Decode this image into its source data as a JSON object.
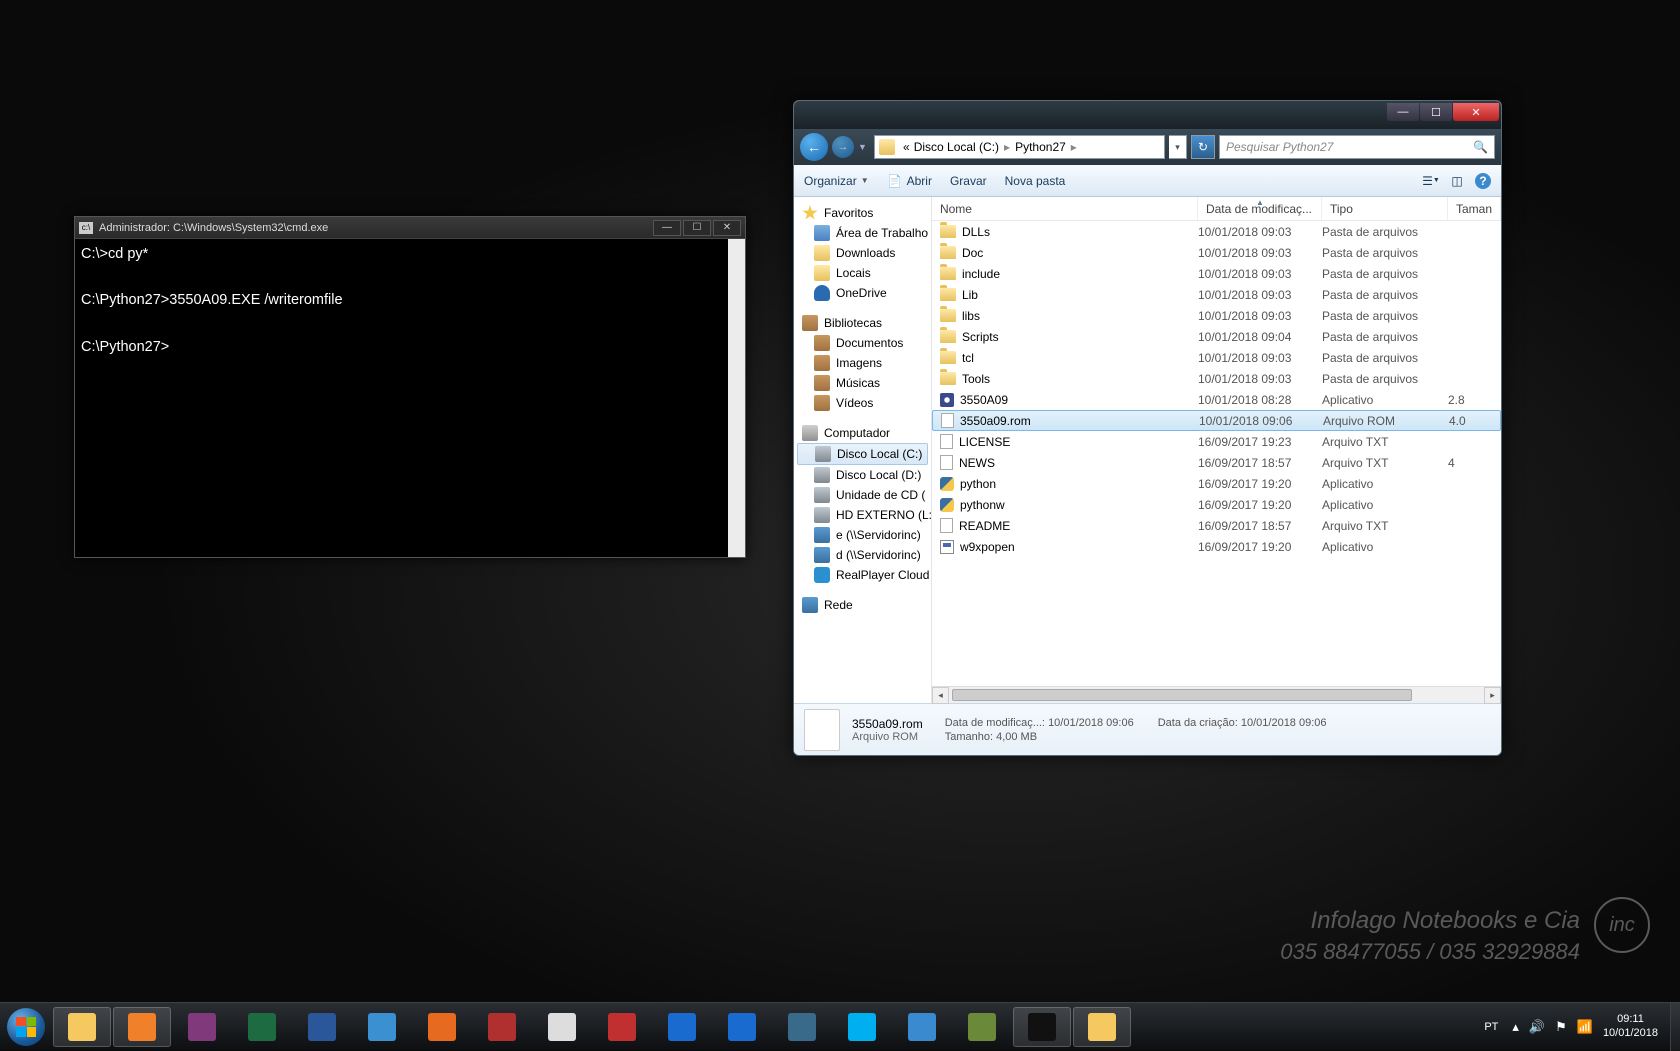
{
  "clock": {
    "time": "09:11",
    "date": "10/01/2018",
    "lang": "PT"
  },
  "watermark": {
    "line1": "Infolago Notebooks e Cia",
    "line2": "035 88477055 / 035 32929884",
    "circle": "inc"
  },
  "cmd": {
    "title": "Administrador: C:\\Windows\\System32\\cmd.exe",
    "body": "C:\\>cd py*\n\nC:\\Python27>3550A09.EXE /writeromfile\n\nC:\\Python27>"
  },
  "explorer": {
    "breadcrumb": {
      "prefix": "«",
      "part1": "Disco Local (C:)",
      "part2": "Python27"
    },
    "search_placeholder": "Pesquisar Python27",
    "toolbar": {
      "organize": "Organizar",
      "open": "Abrir",
      "burn": "Gravar",
      "newfolder": "Nova pasta"
    },
    "sidebar": {
      "favorites": {
        "label": "Favoritos",
        "items": [
          "Área de Trabalho",
          "Downloads",
          "Locais",
          "OneDrive"
        ]
      },
      "libraries": {
        "label": "Bibliotecas",
        "items": [
          "Documentos",
          "Imagens",
          "Músicas",
          "Vídeos"
        ]
      },
      "computer": {
        "label": "Computador",
        "items": [
          "Disco Local (C:)",
          "Disco Local (D:)",
          "Unidade de CD (",
          "HD EXTERNO (L:",
          "e (\\\\Servidorinc)",
          "d (\\\\Servidorinc)",
          "RealPlayer Cloud"
        ]
      },
      "network": {
        "label": "Rede"
      }
    },
    "columns": {
      "name": "Nome",
      "date": "Data de modificaç...",
      "type": "Tipo",
      "size": "Taman"
    },
    "files": [
      {
        "ico": "folder",
        "name": "DLLs",
        "date": "10/01/2018 09:03",
        "type": "Pasta de arquivos",
        "size": ""
      },
      {
        "ico": "folder",
        "name": "Doc",
        "date": "10/01/2018 09:03",
        "type": "Pasta de arquivos",
        "size": ""
      },
      {
        "ico": "folder",
        "name": "include",
        "date": "10/01/2018 09:03",
        "type": "Pasta de arquivos",
        "size": ""
      },
      {
        "ico": "folder",
        "name": "Lib",
        "date": "10/01/2018 09:03",
        "type": "Pasta de arquivos",
        "size": ""
      },
      {
        "ico": "folder",
        "name": "libs",
        "date": "10/01/2018 09:03",
        "type": "Pasta de arquivos",
        "size": ""
      },
      {
        "ico": "folder",
        "name": "Scripts",
        "date": "10/01/2018 09:04",
        "type": "Pasta de arquivos",
        "size": ""
      },
      {
        "ico": "folder",
        "name": "tcl",
        "date": "10/01/2018 09:03",
        "type": "Pasta de arquivos",
        "size": ""
      },
      {
        "ico": "folder",
        "name": "Tools",
        "date": "10/01/2018 09:03",
        "type": "Pasta de arquivos",
        "size": ""
      },
      {
        "ico": "exe",
        "name": "3550A09",
        "date": "10/01/2018 08:28",
        "type": "Aplicativo",
        "size": "2.8"
      },
      {
        "ico": "file",
        "name": "3550a09.rom",
        "date": "10/01/2018 09:06",
        "type": "Arquivo ROM",
        "size": "4.0",
        "selected": true
      },
      {
        "ico": "file",
        "name": "LICENSE",
        "date": "16/09/2017 19:23",
        "type": "Arquivo TXT",
        "size": ""
      },
      {
        "ico": "file",
        "name": "NEWS",
        "date": "16/09/2017 18:57",
        "type": "Arquivo TXT",
        "size": "4"
      },
      {
        "ico": "py",
        "name": "python",
        "date": "16/09/2017 19:20",
        "type": "Aplicativo",
        "size": ""
      },
      {
        "ico": "py",
        "name": "pythonw",
        "date": "16/09/2017 19:20",
        "type": "Aplicativo",
        "size": ""
      },
      {
        "ico": "file",
        "name": "README",
        "date": "16/09/2017 18:57",
        "type": "Arquivo TXT",
        "size": ""
      },
      {
        "ico": "app",
        "name": "w9xpopen",
        "date": "16/09/2017 19:20",
        "type": "Aplicativo",
        "size": ""
      }
    ],
    "details": {
      "filename": "3550a09.rom",
      "filetype": "Arquivo ROM",
      "mod_label": "Data de modificaç...:",
      "mod_value": "10/01/2018 09:06",
      "size_label": "Tamanho:",
      "size_value": "4,00 MB",
      "created_label": "Data da criação:",
      "created_value": "10/01/2018 09:06"
    }
  },
  "taskbar_icons": [
    "explorer",
    "wmp",
    "onenote",
    "excel",
    "word",
    "ie",
    "firefox",
    "tool",
    "chrome",
    "pdf",
    "teamviewer",
    "outlook",
    "app1",
    "skype",
    "app2",
    "calc",
    "cmd",
    "explorer2"
  ]
}
